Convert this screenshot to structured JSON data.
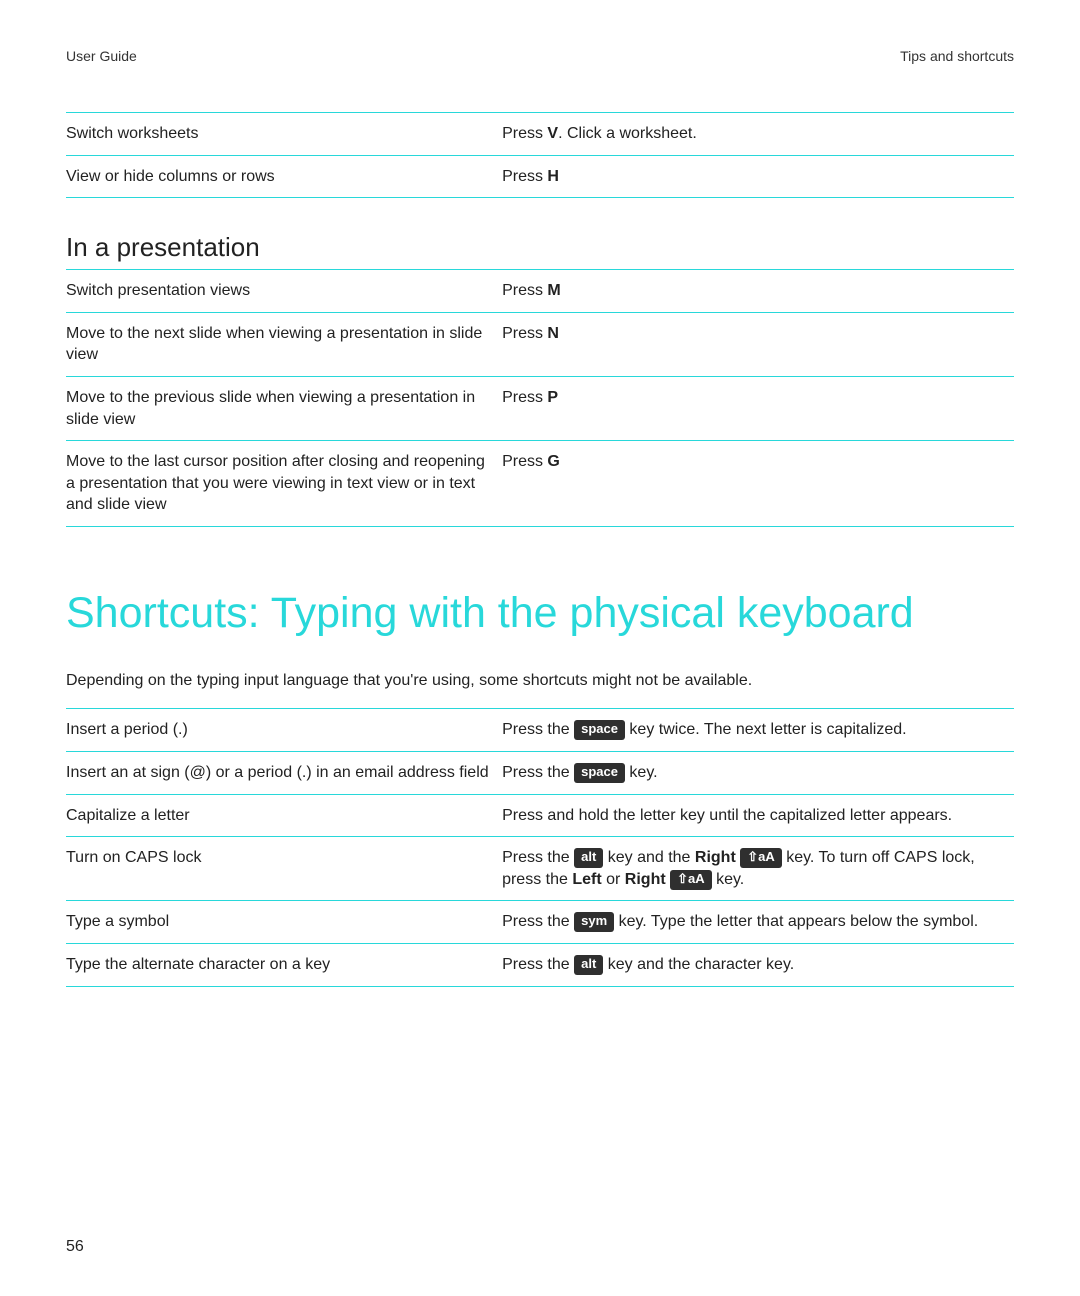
{
  "header": {
    "left": "User Guide",
    "right": "Tips and shortcuts"
  },
  "page_number": "56",
  "keycaps": {
    "space": "space",
    "alt": "alt",
    "sym": "sym",
    "shift": "⇧aA"
  },
  "table_spreadsheet": [
    {
      "desc": "Switch worksheets",
      "instr": [
        {
          "t": "Press "
        },
        {
          "b": "V"
        },
        {
          "t": ". Click a worksheet."
        }
      ]
    },
    {
      "desc": "View or hide columns or rows",
      "instr": [
        {
          "t": "Press "
        },
        {
          "b": "H"
        }
      ]
    }
  ],
  "subhead_presentation": "In a presentation",
  "table_presentation": [
    {
      "desc": "Switch presentation views",
      "instr": [
        {
          "t": "Press "
        },
        {
          "b": "M"
        }
      ]
    },
    {
      "desc": "Move to the next slide when viewing a presentation in slide view",
      "instr": [
        {
          "t": "Press "
        },
        {
          "b": "N"
        }
      ]
    },
    {
      "desc": "Move to the previous slide when viewing a presentation in slide view",
      "instr": [
        {
          "t": "Press "
        },
        {
          "b": "P"
        }
      ]
    },
    {
      "desc": "Move to the last cursor position after closing and reopening a presentation that you were viewing in text view or in text and slide view",
      "instr": [
        {
          "t": "Press "
        },
        {
          "b": "G"
        }
      ]
    }
  ],
  "section_title": "Shortcuts: Typing with the physical keyboard",
  "intro": "Depending on the typing input language that you're using, some shortcuts might not be available.",
  "table_typing": [
    {
      "desc": "Insert a period (.)",
      "instr": [
        {
          "t": "Press the "
        },
        {
          "k": "space"
        },
        {
          "t": " key twice. The next letter is capitalized."
        }
      ]
    },
    {
      "desc": "Insert an at sign (@) or a period (.) in an email address field",
      "instr": [
        {
          "t": "Press the "
        },
        {
          "k": "space"
        },
        {
          "t": " key."
        }
      ]
    },
    {
      "desc": "Capitalize a letter",
      "instr": [
        {
          "t": "Press and hold the letter key until the capitalized letter appears."
        }
      ]
    },
    {
      "desc": "Turn on CAPS lock",
      "instr": [
        {
          "t": "Press the "
        },
        {
          "k": "alt"
        },
        {
          "t": " key and the "
        },
        {
          "b": "Right"
        },
        {
          "t": " "
        },
        {
          "k": "shift"
        },
        {
          "t": " key. To turn off CAPS lock, press the "
        },
        {
          "b": "Left"
        },
        {
          "t": " or "
        },
        {
          "b": "Right"
        },
        {
          "t": " "
        },
        {
          "k": "shift"
        },
        {
          "t": " key."
        }
      ]
    },
    {
      "desc": "Type a symbol",
      "instr": [
        {
          "t": "Press the "
        },
        {
          "k": "sym"
        },
        {
          "t": " key. Type the letter that appears below the symbol."
        }
      ]
    },
    {
      "desc": "Type the alternate character on a key",
      "instr": [
        {
          "t": "Press the "
        },
        {
          "k": "alt"
        },
        {
          "t": " key and the character key."
        }
      ]
    }
  ]
}
